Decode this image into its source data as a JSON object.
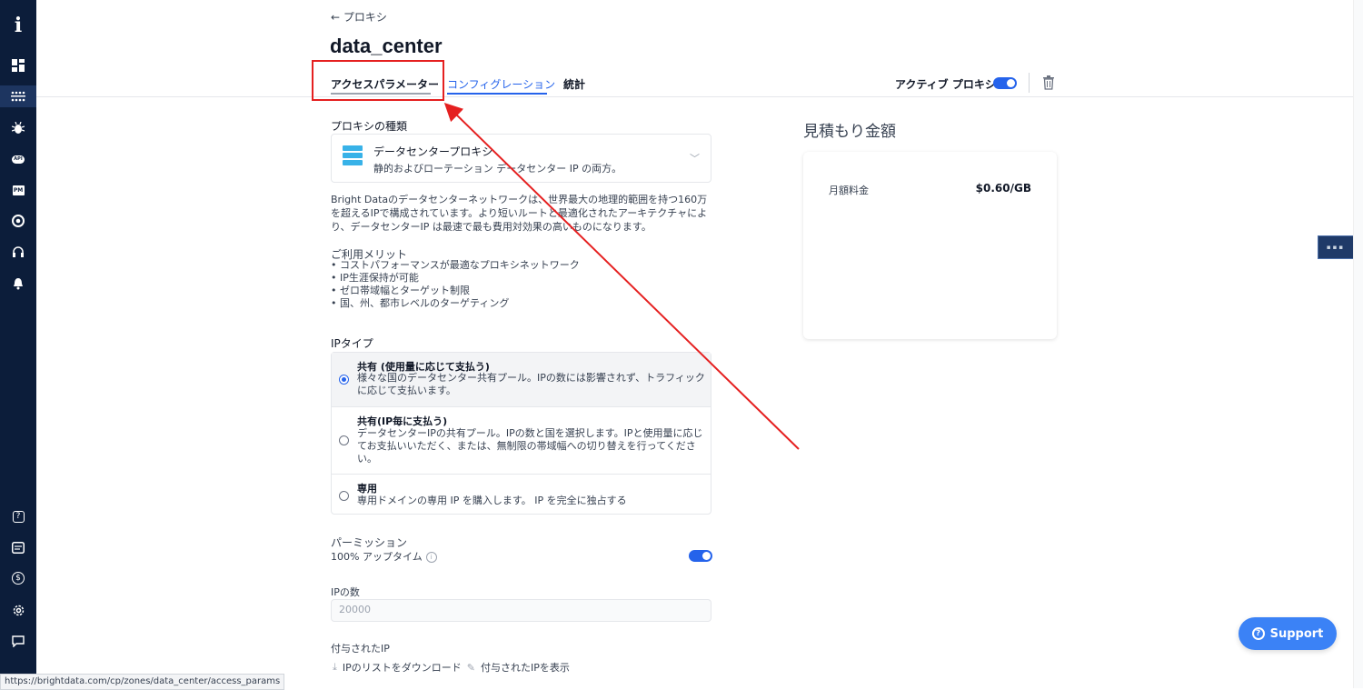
{
  "nav": {
    "back_label": "← プロキシ"
  },
  "page": {
    "title": "data_center"
  },
  "tabs": [
    {
      "label": "アクセスパラメーター"
    },
    {
      "label": "コンフィグレーション"
    },
    {
      "label": "統計"
    }
  ],
  "header": {
    "active_proxy_label": "アクティブ プロキシ"
  },
  "proxy_type": {
    "section_label": "プロキシの種類",
    "name": "データセンタープロキシ",
    "description": "静的およびローテーション データセンター IP の両方。"
  },
  "description": "Bright Dataのデータセンターネットワークは、世界最大の地理的範囲を持つ160万を超えるIPで構成されています。より短いルートと最適化されたアーキテクチャにより、データセンターIP は最速で最も費用対効果の高いものになります。",
  "benefits": {
    "title": "ご利用メリット",
    "items": [
      "コストパフォーマンスが最適なプロキシネットワーク",
      "IP生涯保持が可能",
      "ゼロ帯域幅とターゲット制限",
      "国、州、都市レベルのターゲティング"
    ]
  },
  "ip_type": {
    "section_label": "IPタイプ",
    "options": [
      {
        "title": "共有 (使用量に応じて支払う)",
        "description": "様々な国のデータセンター共有プール。IPの数には影響されず、トラフィックに応じて支払います。",
        "selected": true
      },
      {
        "title": "共有(IP毎に支払う)",
        "description": "データセンターIPの共有プール。IPの数と国を選択します。IPと使用量に応じてお支払いいただく、または、無制限の帯域幅への切り替えを行ってください。",
        "selected": false
      },
      {
        "title": "専用",
        "description": "専用ドメインの専用 IP を購入します。 IP を完全に独占する",
        "selected": false
      }
    ]
  },
  "permission": {
    "section_label": "パーミッション",
    "uptime_label": "100% アップタイム",
    "uptime_enabled": true
  },
  "ip_count": {
    "label": "IPの数",
    "placeholder": "20000"
  },
  "assigned_ip": {
    "label": "付与されたIP",
    "download_link": "IPのリストをダウンロード",
    "show_link": "付与されたIPを表示"
  },
  "estimate": {
    "title": "見積もり金額",
    "row_label": "月額料金",
    "row_value": "$0.60/GB"
  },
  "support": {
    "label": "Support"
  },
  "status_bar": {
    "url": "https://brightdata.com/cp/zones/data_center/access_params"
  },
  "colors": {
    "sidebar": "#0c1d3a",
    "accent": "#2563eb",
    "annotation": "#e52020"
  }
}
